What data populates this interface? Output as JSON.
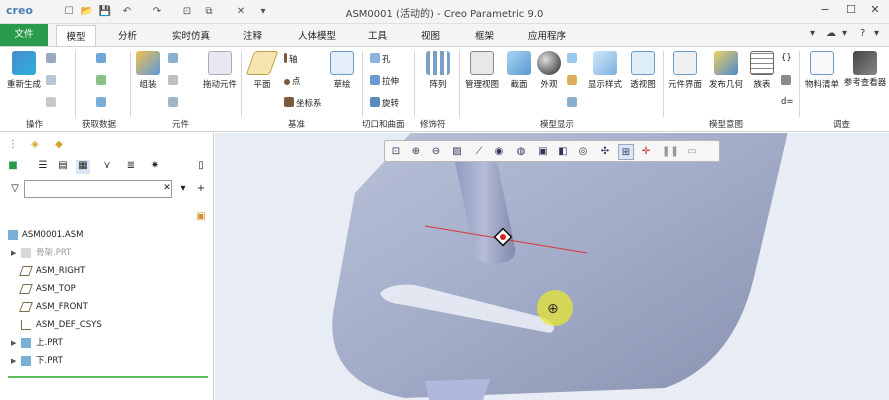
{
  "app": {
    "logo": "creo",
    "title": "ASM0001 (活动的) - Creo Parametric 9.0"
  },
  "quick_access": [
    "☐",
    "📂",
    "💾",
    "↶",
    "↷",
    "⊡",
    "⧉",
    "✕",
    "▾"
  ],
  "window_controls": [
    "−",
    "☐",
    "✕"
  ],
  "menubar": {
    "tabs": [
      "文件",
      "模型",
      "分析",
      "实时仿真",
      "注释",
      "人体模型",
      "工具",
      "视图",
      "框架",
      "应用程序"
    ],
    "right_icons": [
      "▾",
      "☁",
      "▾",
      "?",
      "▾"
    ]
  },
  "ribbon": {
    "operations": {
      "regen": "重新生成",
      "group": "操作"
    },
    "get_data": {
      "group": "获取数据"
    },
    "components": {
      "assemble": "组装",
      "drag": "拖动元件",
      "group": "元件"
    },
    "datum": {
      "plane": "平面",
      "axis": "轴",
      "point": "点",
      "csys": "坐标系",
      "sketch": "草绘",
      "group": "基准"
    },
    "cut_surface": {
      "hole": "孔",
      "extrude": "拉伸",
      "revolve": "旋转",
      "group": "切口和曲面"
    },
    "modifiers": {
      "pattern": "阵列",
      "group": "修饰符"
    },
    "model_display": {
      "manage_views": "管理视图",
      "section": "截面",
      "appearance": "外观",
      "display_style": "显示样式",
      "perspective": "透视图",
      "group": "模型显示"
    },
    "model_intent": {
      "component_interface": "元件界面",
      "publish_geometry": "发布几何",
      "table": "族表",
      "group": "模型意图"
    },
    "investigate": {
      "bom": "物料清单",
      "reference_viewer": "参考查看器",
      "group": "调查"
    }
  },
  "model_tree": {
    "filter_placeholder": "",
    "items": [
      {
        "label": "ASM0001.ASM",
        "icon": "assembly-icon"
      },
      {
        "label": "骨架.PRT",
        "icon": "skeleton-icon"
      },
      {
        "label": "ASM_RIGHT",
        "icon": "datum-plane-icon"
      },
      {
        "label": "ASM_TOP",
        "icon": "datum-plane-icon"
      },
      {
        "label": "ASM_FRONT",
        "icon": "datum-plane-icon"
      },
      {
        "label": "ASM_DEF_CSYS",
        "icon": "csys-icon"
      },
      {
        "label": "上.PRT",
        "icon": "part-icon"
      },
      {
        "label": "下.PRT",
        "icon": "part-icon"
      }
    ]
  },
  "colors": {
    "file_tab": "#2b9a4a",
    "accent": "#4a7fb5",
    "model_body": "#a8b2cc",
    "axis_line": "#dd3333",
    "highlight": "#e6e633"
  }
}
